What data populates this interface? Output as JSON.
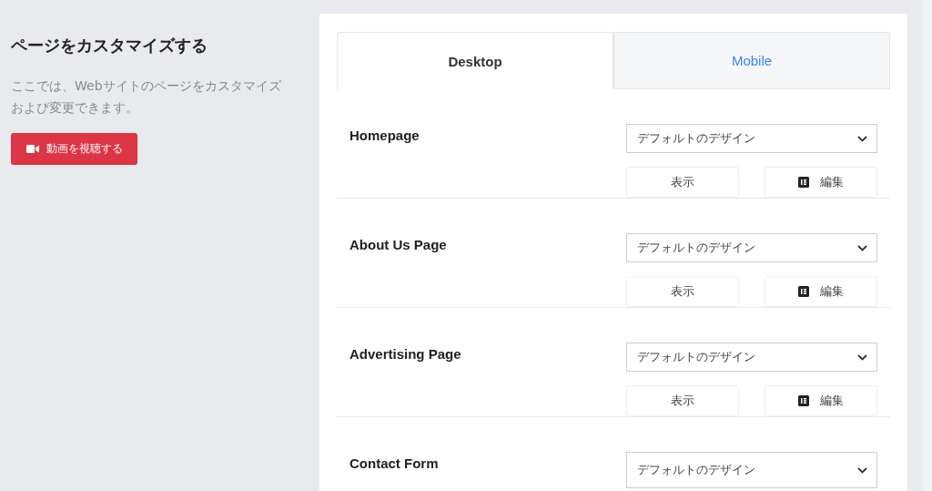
{
  "intro": {
    "title": "ページをカスタマイズする",
    "description": "ここでは、Webサイトのページをカスタマイズおよび変更できます。",
    "video_button": "動画を視聴する"
  },
  "tabs": [
    {
      "label": "Desktop",
      "selected": true
    },
    {
      "label": "Mobile",
      "selected": false
    }
  ],
  "pages": [
    {
      "name": "Homepage",
      "design": "デフォルトのデザイン",
      "view_button": "表示",
      "edit_button": "編集"
    },
    {
      "name": "About Us Page",
      "design": "デフォルトのデザイン",
      "view_button": "表示",
      "edit_button": "編集"
    },
    {
      "name": "Advertising Page",
      "design": "デフォルトのデザイン",
      "view_button": "表示",
      "edit_button": "編集"
    },
    {
      "name": "Contact Form",
      "design": "デフォルトのデザイン"
    }
  ]
}
